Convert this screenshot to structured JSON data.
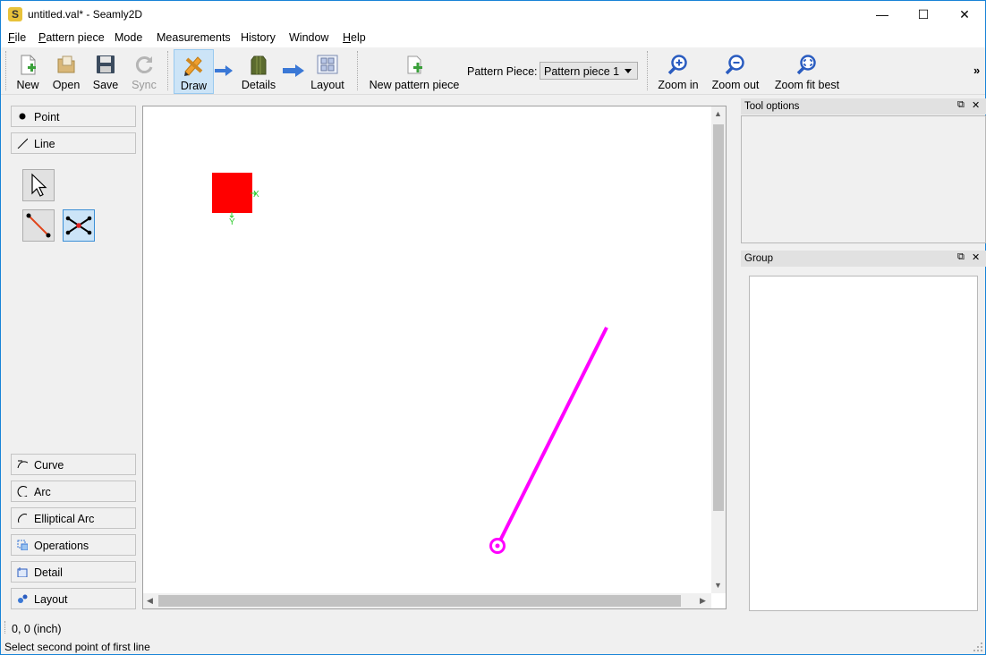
{
  "window": {
    "title": "untitled.val* - Seamly2D",
    "controls": {
      "minimize": "—",
      "maximize": "☐",
      "close": "✕"
    }
  },
  "menu": [
    {
      "mnemonic": "F",
      "rest": "ile"
    },
    {
      "mnemonic": "P",
      "rest": "attern piece"
    },
    {
      "mnemonic": "",
      "rest": "Mode"
    },
    {
      "mnemonic": "",
      "rest": "Measurements"
    },
    {
      "mnemonic": "",
      "rest": "History"
    },
    {
      "mnemonic": "",
      "rest": "Window"
    },
    {
      "mnemonic": "H",
      "rest": "elp"
    }
  ],
  "toolbar": {
    "new": {
      "label": "New",
      "icon": "new-file-icon"
    },
    "open": {
      "label": "Open",
      "icon": "open-folder-icon"
    },
    "save": {
      "label": "Save",
      "icon": "save-icon"
    },
    "sync": {
      "label": "Sync",
      "icon": "sync-icon",
      "disabled": true
    },
    "draw": {
      "label": "Draw",
      "icon": "pencil-ruler-icon",
      "active": true
    },
    "details": {
      "label": "Details",
      "icon": "details-icon"
    },
    "layout": {
      "label": "Layout",
      "icon": "layout-icon"
    },
    "new_piece": {
      "label": "New pattern piece",
      "icon": "new-piece-icon"
    },
    "piece_label": "Pattern Piece:",
    "piece_value": "Pattern piece 1",
    "zoom_in": {
      "label": "Zoom in",
      "icon": "zoom-in-icon"
    },
    "zoom_out": {
      "label": "Zoom out",
      "icon": "zoom-out-icon"
    },
    "zoom_fit": {
      "label": "Zoom fit best",
      "icon": "zoom-fit-icon"
    },
    "more": "»"
  },
  "tools": {
    "point": "Point",
    "line": "Line",
    "curve": "Curve",
    "arc": "Arc",
    "elliptical_arc": "Elliptical Arc",
    "operations": "Operations",
    "detail": "Detail",
    "layout": "Layout"
  },
  "canvas": {
    "axis_x": "X",
    "axis_y": "Y",
    "line_color": "#ff00ff",
    "origin_color": "#ff0000"
  },
  "docks": {
    "tool_options": "Tool options",
    "group": "Group"
  },
  "status": {
    "coordinates": "0, 0 (inch)",
    "message": "Select second point of first line"
  },
  "colors": {
    "accent": "#0078d7",
    "active_tool": "#cce4f7"
  }
}
